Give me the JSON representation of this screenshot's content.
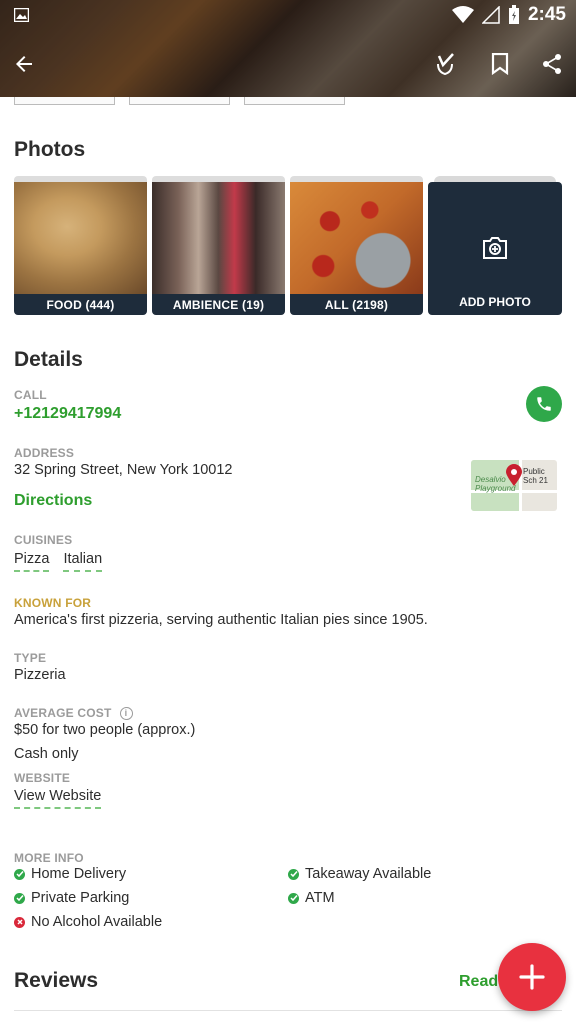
{
  "status_bar": {
    "time": "2:45"
  },
  "menu_strip_count": 3,
  "photos": {
    "title": "Photos",
    "cards": [
      {
        "label": "FOOD (444)"
      },
      {
        "label": "AMBIENCE (19)"
      },
      {
        "label": "ALL (2198)"
      }
    ],
    "add_label": "ADD PHOTO"
  },
  "details": {
    "title": "Details",
    "call_label": "CALL",
    "phone": "+12129417994",
    "address_label": "ADDRESS",
    "address": "32 Spring Street, New York 10012",
    "directions": "Directions",
    "map": {
      "park_name": "Desalvio Playground",
      "school_name": "Public Sch 21"
    },
    "cuisines_label": "CUISINES",
    "cuisines": [
      "Pizza",
      "Italian"
    ],
    "known_for_label": "KNOWN FOR",
    "known_for": "America's first pizzeria, serving authentic Italian pies since 1905.",
    "type_label": "TYPE",
    "type": "Pizzeria",
    "avg_cost_label": "AVERAGE COST",
    "avg_cost": "$50 for two people (approx.)",
    "payment": "Cash only",
    "website_label": "WEBSITE",
    "website": "View Website",
    "more_info_label": "MORE INFO",
    "more_info": [
      {
        "text": "Home Delivery",
        "available": true
      },
      {
        "text": "Takeaway Available",
        "available": true
      },
      {
        "text": "Private Parking",
        "available": true
      },
      {
        "text": "ATM",
        "available": true
      },
      {
        "text": "No Alcohol Available",
        "available": false
      }
    ]
  },
  "reviews": {
    "title": "Reviews",
    "read_all": "Read all"
  },
  "colors": {
    "accent_green": "#2e9e2e",
    "fab_red": "#e8313f",
    "photo_caption_bg": "#1e2c3b",
    "known_for_gold": "#c8a13a"
  }
}
